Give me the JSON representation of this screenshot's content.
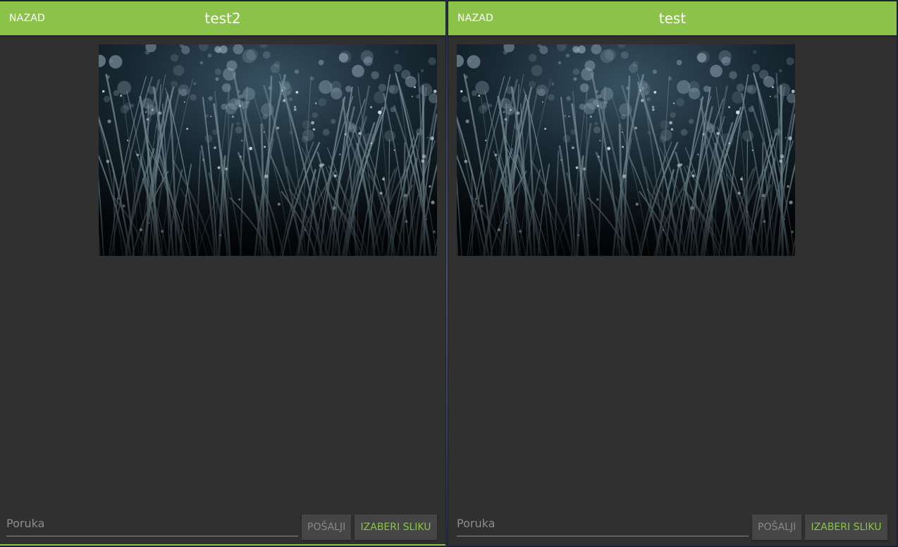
{
  "left_pane": {
    "back_label": "NAZAD",
    "title": "test2",
    "message_image": "grass-with-dew-photo",
    "input_placeholder": "Poruka",
    "send_label": "POŠALJI",
    "pick_image_label": "IZABERI SLIKU"
  },
  "right_pane": {
    "back_label": "NAZAD",
    "title": "test",
    "message_image": "grass-with-dew-photo",
    "input_placeholder": "Poruka",
    "send_label": "POŠALJI",
    "pick_image_label": "IZABERI SLIKU"
  },
  "colors": {
    "accent": "#8bc34a",
    "background": "#303030",
    "button": "#454545"
  }
}
